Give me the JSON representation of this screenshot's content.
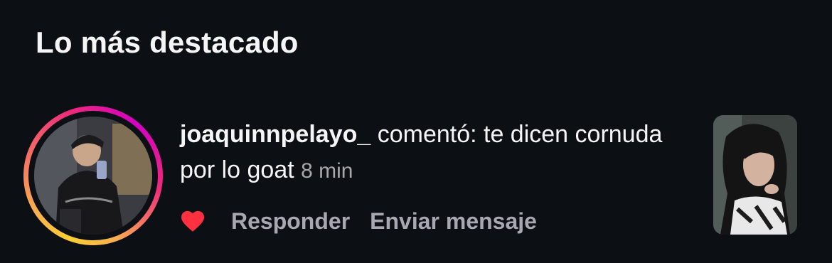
{
  "section": {
    "title": "Lo más destacado"
  },
  "notification": {
    "username": "joaquinnpelayo_",
    "comment": " comentó: te dicen cornuda por lo goat",
    "timestamp": "8 min",
    "actions": {
      "like_icon": "heart-filled-icon",
      "reply_label": "Responder",
      "message_label": "Enviar mensaje"
    }
  },
  "colors": {
    "background": "#0c1014",
    "text_primary": "#f5f5f5",
    "text_secondary": "#a8a8b3",
    "like_red": "#ff3040"
  }
}
